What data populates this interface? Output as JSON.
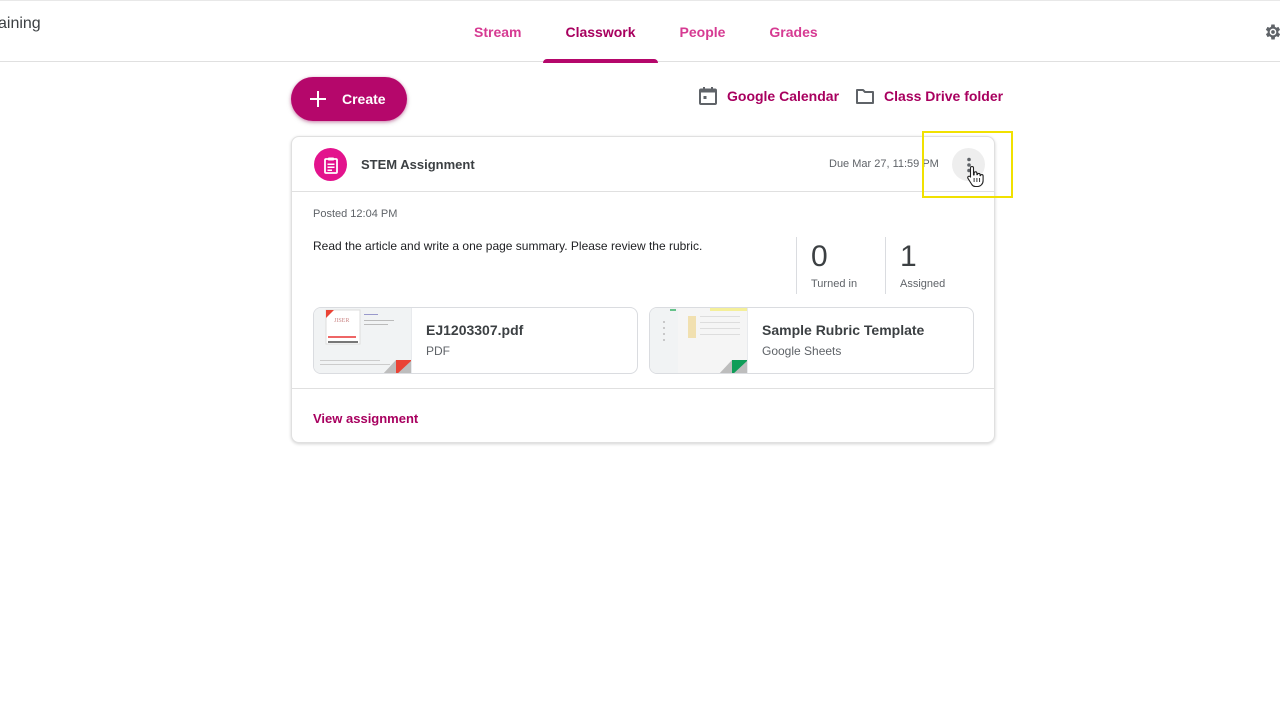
{
  "header": {
    "class_name": "aining",
    "tabs": [
      {
        "label": "Stream",
        "active": false
      },
      {
        "label": "Classwork",
        "active": true
      },
      {
        "label": "People",
        "active": false
      },
      {
        "label": "Grades",
        "active": false
      }
    ],
    "settings_icon": "gear-icon"
  },
  "toolbar": {
    "create_label": "Create",
    "links": [
      {
        "label": "Google Calendar",
        "icon": "calendar-icon"
      },
      {
        "label": "Class Drive folder",
        "icon": "folder-icon"
      }
    ]
  },
  "assignment": {
    "title": "STEM Assignment",
    "due": "Due Mar 27, 11:59 PM",
    "posted": "Posted 12:04 PM",
    "instructions": "Read the article and write a one page summary. Please review the rubric.",
    "stats": [
      {
        "value": "0",
        "label": "Turned in"
      },
      {
        "value": "1",
        "label": "Assigned"
      }
    ],
    "attachments": [
      {
        "title": "EJ1203307.pdf",
        "type": "PDF",
        "corner_color": "#ea4335"
      },
      {
        "title": "Sample Rubric Template",
        "type": "Google Sheets",
        "corner_color": "#0f9d58"
      }
    ],
    "view_label": "View assignment"
  },
  "colors": {
    "accent": "#b5076b",
    "accent_text": "#a8005f",
    "tab_inactive": "#d63a92",
    "assignment_icon_bg": "#e3138d",
    "annotation_highlight": "#f1e100"
  }
}
